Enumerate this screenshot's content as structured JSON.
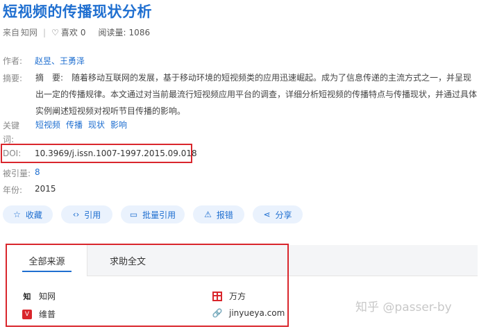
{
  "article": {
    "title": "短视频的传播现状分析",
    "source_prefix": "来自",
    "source": "知网",
    "likes_label": "喜欢",
    "likes": "0",
    "reads_label": "阅读量:",
    "reads": "1086"
  },
  "fields": {
    "author_label": "作者:",
    "authors": [
      "赵昱",
      "王勇泽"
    ],
    "author_sep": "、",
    "abstract_label": "摘要:",
    "abstract": "摘　要:　随着移动互联网的发展，基于移动环境的短视频类的应用迅速崛起。成为了信息传递的主流方式之一，并呈现出一定的传播规律。本文通过对当前最流行短视频应用平台的调查，详细分析短视频的传播特点与传播现状，并通过具体实例阐述短视频对视听节目传播的影响。",
    "keywords_label": "关键词:",
    "keywords": [
      "短视频",
      "传播",
      "现状",
      "影响"
    ],
    "doi_label": "DOI:",
    "doi": "10.3969/j.issn.1007-1997.2015.09.018",
    "cited_label": "被引量:",
    "cited": "8",
    "year_label": "年份:",
    "year": "2015"
  },
  "actions": {
    "collect": "收藏",
    "cite": "引用",
    "batch_cite": "批量引用",
    "report": "报错",
    "share": "分享"
  },
  "sources": {
    "tab_all": "全部来源",
    "tab_help": "求助全文",
    "items": {
      "cnki": "知网",
      "wanfang": "万方",
      "vip": "维普",
      "jinyueya": "jinyueya.com"
    }
  },
  "watermark": "知乎 @passer-by",
  "colors": {
    "accent": "#1f6fd0",
    "highlight_box": "#d9262c",
    "button_bg": "#eaf2fd"
  }
}
